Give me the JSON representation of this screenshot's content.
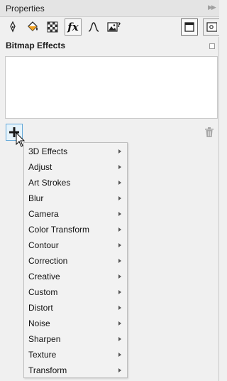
{
  "titlebar": {
    "title": "Properties",
    "collapse_icon": "double-chevron-right-icon"
  },
  "toolbar": {
    "buttons": [
      {
        "name": "pen-outline-icon"
      },
      {
        "name": "fill-bucket-icon"
      },
      {
        "name": "transparency-checker-icon"
      },
      {
        "name": "fx-effects-icon",
        "label": "fx",
        "active": true
      },
      {
        "name": "curve-icon"
      },
      {
        "name": "bitmap-info-icon"
      },
      {
        "name": "frame-icon"
      },
      {
        "name": "frame-settings-icon"
      }
    ]
  },
  "section": {
    "title": "Bitmap Effects"
  },
  "actions": {
    "add_icon": "plus-icon",
    "delete_icon": "trash-icon"
  },
  "menu": {
    "items": [
      {
        "label": "3D Effects",
        "accel": "3"
      },
      {
        "label": "Adjust",
        "accel": "A"
      },
      {
        "label": "Art Strokes",
        "accel": "A"
      },
      {
        "label": "Blur",
        "accel": "B"
      },
      {
        "label": "Camera",
        "accel": "C"
      },
      {
        "label": "Color Transform",
        "accel": "l"
      },
      {
        "label": "Contour",
        "accel": "o"
      },
      {
        "label": "Correction",
        "accel": "r"
      },
      {
        "label": "Creative",
        "accel": "v"
      },
      {
        "label": "Custom",
        "accel": "u"
      },
      {
        "label": "Distort",
        "accel": "D"
      },
      {
        "label": "Noise",
        "accel": "N"
      },
      {
        "label": "Sharpen",
        "accel": "S"
      },
      {
        "label": "Texture",
        "accel": "T"
      },
      {
        "label": "Transform",
        "accel": "a"
      }
    ]
  },
  "colors": {
    "accent": "#63a8d8",
    "panel": "#f0f0f0"
  }
}
